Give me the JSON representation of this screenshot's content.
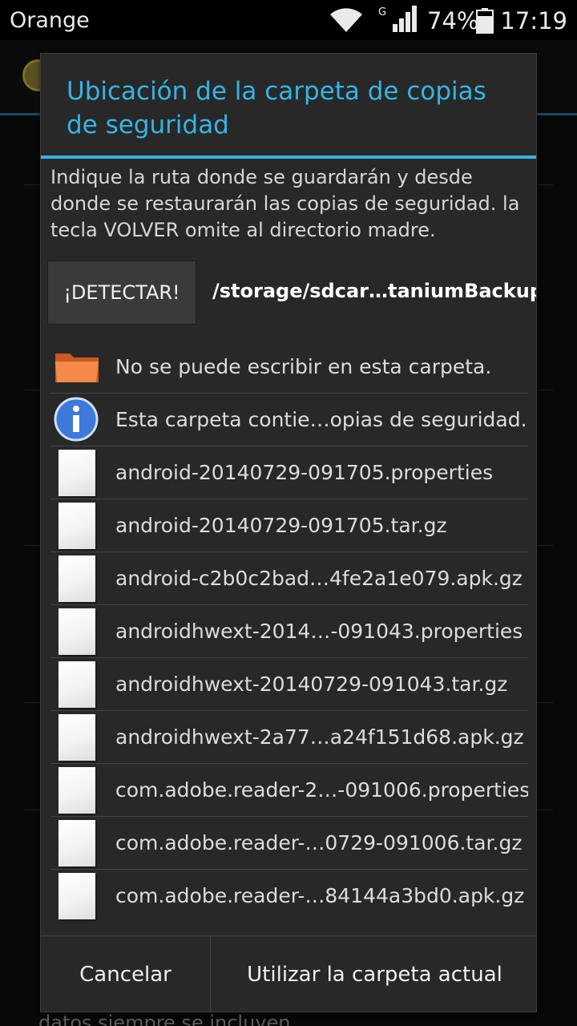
{
  "status_bar": {
    "carrier": "Orange",
    "network_type": "G",
    "battery_percent": "74%",
    "time": "17:19",
    "icons": [
      "wifi-icon",
      "signal-icon",
      "battery-icon"
    ]
  },
  "background": {
    "footer_text": "datos siempre se incluyen."
  },
  "dialog": {
    "title": "Ubicación de la carpeta de copias de seguridad",
    "description": "Indique la ruta donde se guardarán y desde donde se restaurarán las copias de seguridad. la tecla VOLVER omite al directorio madre.",
    "detect_button": "¡DETECTAR!",
    "current_path": "/storage/sdcar…taniumBackup",
    "items": [
      {
        "icon": "folder-icon",
        "label": "No se puede escribir en esta carpeta."
      },
      {
        "icon": "info-icon",
        "label": "Esta carpeta contie…opias de seguridad."
      },
      {
        "icon": "file-icon",
        "label": "android-20140729-091705.properties"
      },
      {
        "icon": "file-icon",
        "label": "android-20140729-091705.tar.gz"
      },
      {
        "icon": "file-icon",
        "label": "android-c2b0c2bad…4fe2a1e079.apk.gz"
      },
      {
        "icon": "file-icon",
        "label": "androidhwext-2014…-091043.properties"
      },
      {
        "icon": "file-icon",
        "label": "androidhwext-20140729-091043.tar.gz"
      },
      {
        "icon": "file-icon",
        "label": "androidhwext-2a77…a24f151d68.apk.gz"
      },
      {
        "icon": "file-icon",
        "label": "com.adobe.reader-2…-091006.properties"
      },
      {
        "icon": "file-icon",
        "label": "com.adobe.reader-…0729-091006.tar.gz"
      },
      {
        "icon": "file-icon",
        "label": "com.adobe.reader-…84144a3bd0.apk.gz"
      },
      {
        "icon": "file-icon",
        "label": ""
      }
    ],
    "cancel_button": "Cancelar",
    "use_folder_button": "Utilizar la carpeta actual"
  },
  "colors": {
    "accent": "#33b5e5",
    "dialog_background": "#282828",
    "folder": "#f07838"
  }
}
